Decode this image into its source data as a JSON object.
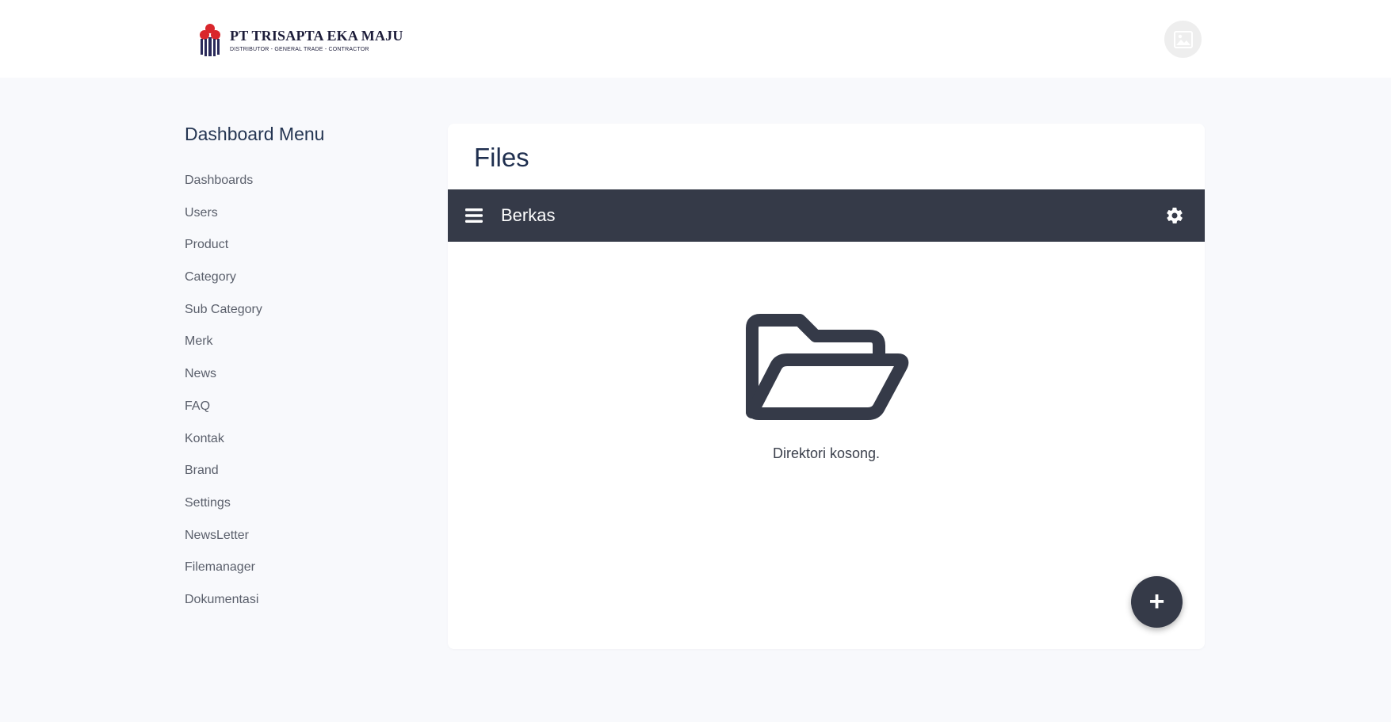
{
  "header": {
    "brand_title": "PT TRISAPTA EKA MAJU",
    "brand_subtitle": "DISTRIBUTOR - GENERAL TRADE - CONTRACTOR",
    "avatar_icon": "image-placeholder-icon"
  },
  "sidebar": {
    "title": "Dashboard Menu",
    "items": [
      {
        "label": "Dashboards"
      },
      {
        "label": "Users"
      },
      {
        "label": "Product"
      },
      {
        "label": "Category"
      },
      {
        "label": "Sub Category"
      },
      {
        "label": "Merk"
      },
      {
        "label": "News"
      },
      {
        "label": "FAQ"
      },
      {
        "label": "Kontak"
      },
      {
        "label": "Brand"
      },
      {
        "label": "Settings"
      },
      {
        "label": "NewsLetter"
      },
      {
        "label": "Filemanager"
      },
      {
        "label": "Dokumentasi"
      }
    ]
  },
  "main": {
    "title": "Files",
    "file_manager": {
      "toolbar_title": "Berkas",
      "menu_icon": "hamburger-icon",
      "settings_icon": "gear-icon",
      "empty_icon": "folder-open-icon",
      "empty_message": "Direktori kosong.",
      "add_button_icon": "plus-icon",
      "add_button_symbol": "+"
    }
  },
  "colors": {
    "toolbar_bg": "#353a48",
    "page_bg": "#f8f9fc",
    "heading": "#1f2f4f"
  }
}
